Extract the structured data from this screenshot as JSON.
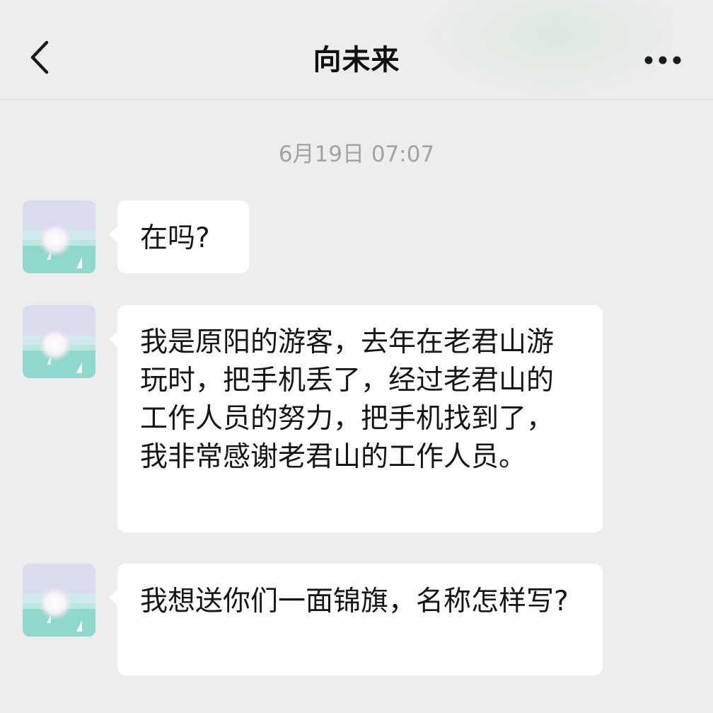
{
  "header": {
    "title": "向未来",
    "back_icon": "chevron-left-icon",
    "more_icon": "more-horizontal-icon"
  },
  "timestamp": "6月19日 07:07",
  "messages": [
    {
      "sender": "contact",
      "text": "在吗?"
    },
    {
      "sender": "contact",
      "text": "我是原阳的游客，去年在老君山游玩时，把手机丢了，经过老君山的工作人员的努力，把手机找到了，我非常感谢老君山的工作人员。"
    },
    {
      "sender": "contact",
      "text": "我想送你们一面锦旗，名称怎样写?"
    }
  ],
  "colors": {
    "background": "#ededed",
    "bubble": "#ffffff",
    "timestamp": "#a3a3a3"
  }
}
